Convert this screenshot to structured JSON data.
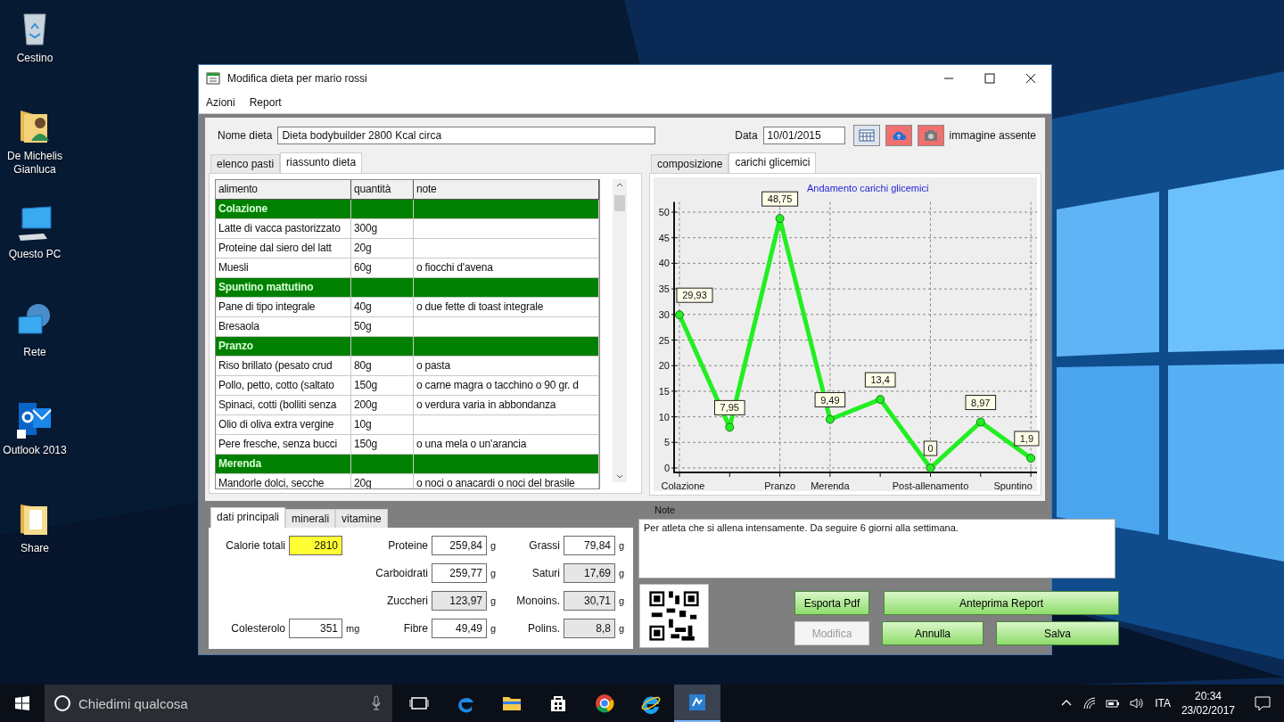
{
  "desktop": {
    "icons": [
      {
        "label": "Cestino",
        "kind": "bin"
      },
      {
        "label": "De Michelis Gianluca",
        "kind": "user"
      },
      {
        "label": "Questo PC",
        "kind": "pc"
      },
      {
        "label": "Rete",
        "kind": "network"
      },
      {
        "label": "Outlook 2013",
        "kind": "outlook"
      },
      {
        "label": "Share",
        "kind": "folder"
      }
    ]
  },
  "window": {
    "title": "Modifica dieta per mario rossi"
  },
  "menu": [
    "Azioni",
    "Report"
  ],
  "header": {
    "name_label": "Nome dieta",
    "name_value": "Dieta bodybuilder 2800 Kcal circa",
    "date_label": "Data",
    "date_value": "10/01/2015",
    "image_status": "immagine assente"
  },
  "left_tabs": [
    {
      "label": "elenco pasti",
      "selected": false
    },
    {
      "label": "riassunto dieta",
      "selected": true
    }
  ],
  "table": {
    "columns": [
      "alimento",
      "quantità",
      "note"
    ],
    "rows": [
      {
        "kind": "meal",
        "cells": [
          "Colazione"
        ]
      },
      {
        "kind": "food",
        "cells": [
          "Latte di vacca pastorizzato",
          "300g"
        ]
      },
      {
        "kind": "food",
        "cells": [
          "Proteine dal siero del latt",
          "20g"
        ]
      },
      {
        "kind": "food",
        "cells": [
          "Muesli",
          "60g",
          "o fiocchi d'avena"
        ]
      },
      {
        "kind": "meal",
        "cells": [
          "Spuntino mattutino"
        ]
      },
      {
        "kind": "food",
        "cells": [
          "Pane di tipo integrale",
          "40g",
          "o due fette di toast integrale"
        ]
      },
      {
        "kind": "food",
        "cells": [
          "Bresaola",
          "50g"
        ]
      },
      {
        "kind": "meal",
        "cells": [
          "Pranzo"
        ]
      },
      {
        "kind": "food",
        "cells": [
          "Riso brillato (pesato crud",
          "80g",
          "o pasta"
        ]
      },
      {
        "kind": "food",
        "cells": [
          "Pollo, petto, cotto (saltato",
          "150g",
          "o carne magra o tacchino o 90 gr. d"
        ]
      },
      {
        "kind": "food",
        "cells": [
          "Spinaci, cotti (bolliti senza",
          "200g",
          "o verdura varia in abbondanza"
        ]
      },
      {
        "kind": "food",
        "cells": [
          "Olio di oliva extra vergine",
          "10g"
        ]
      },
      {
        "kind": "food",
        "cells": [
          "Pere fresche, senza bucci",
          "150g",
          "o una mela o un'arancia"
        ]
      },
      {
        "kind": "meal",
        "cells": [
          "Merenda"
        ]
      },
      {
        "kind": "food",
        "cells": [
          "Mandorle dolci, secche",
          "20g",
          "o noci o anacardi o noci del brasile"
        ]
      }
    ]
  },
  "chart_tabs": [
    {
      "label": "composizione",
      "selected": false
    },
    {
      "label": "carichi glicemici",
      "selected": true
    }
  ],
  "chart": {
    "chart_data": {
      "type": "line",
      "title": "Andamento carichi glicemici",
      "categories": [
        "Colazione",
        null,
        "Pranzo",
        "Merenda",
        null,
        "Post-allenamento",
        null,
        "Spuntino"
      ],
      "yticks": [
        0,
        5,
        10,
        15,
        20,
        25,
        30,
        35,
        40,
        45,
        50
      ],
      "ylim": [
        0,
        52
      ],
      "grid": true,
      "series": [
        {
          "color": "#22ee22",
          "marker": true,
          "values": [
            29.93,
            7.95,
            48.75,
            9.49,
            13.4,
            0,
            8.97,
            1.92
          ]
        }
      ],
      "value_labels": [
        "29,93",
        "7,95",
        "48,75",
        "9,49",
        "13,4",
        "0",
        "8,97",
        "1,9"
      ]
    }
  },
  "bottom_tabs": [
    {
      "label": "dati principali",
      "selected": true
    },
    {
      "label": "minerali",
      "selected": false
    },
    {
      "label": "vitamine",
      "selected": false
    }
  ],
  "nutrients": {
    "rows": [
      {
        "left": {
          "label": "Calorie totali",
          "value": "2810",
          "highlighted": true,
          "readonly": false
        },
        "middle": {
          "label": "Proteine",
          "value": "259,84",
          "unit": "g",
          "highlighted": false,
          "readonly": false
        },
        "right": {
          "label": "Grassi",
          "value": "79,84",
          "unit": "g",
          "highlighted": false,
          "readonly": false
        }
      },
      {
        "middle": {
          "label": "Carboidrati",
          "value": "259,77",
          "unit": "g",
          "highlighted": false,
          "readonly": false
        },
        "right": {
          "label": "Saturi",
          "value": "17,69",
          "unit": "g",
          "highlighted": false,
          "readonly": true
        }
      },
      {
        "middle": {
          "label": "Zuccheri",
          "value": "123,97",
          "unit": "g",
          "highlighted": false,
          "readonly": true
        },
        "right": {
          "label": "Monoins.",
          "value": "30,71",
          "unit": "g",
          "highlighted": false,
          "readonly": true
        }
      },
      {
        "left": {
          "label": "Colesterolo",
          "value": "351",
          "unit": "mg",
          "highlighted": false,
          "readonly": false
        },
        "middle": {
          "label": "Fibre",
          "value": "49,49",
          "unit": "g",
          "highlighted": false,
          "readonly": false
        },
        "right": {
          "label": "Polins.",
          "value": "8,8",
          "unit": "g",
          "highlighted": false,
          "readonly": true
        }
      }
    ]
  },
  "note": {
    "label": "Note",
    "value": "Per atleta che si allena intensamente. Da seguire 6 giorni alla settimana."
  },
  "buttons": [
    {
      "label": "Esporta Pdf",
      "disabled": false
    },
    {
      "label": "Anteprima Report",
      "disabled": false
    },
    {
      "label": "Modifica",
      "disabled": true
    },
    {
      "label": "Annulla",
      "disabled": false
    },
    {
      "label": "Salva",
      "disabled": false
    }
  ],
  "taskbar": {
    "search_placeholder": "Chiedimi qualcosa",
    "apps": [
      {
        "kind": "taskview",
        "active": false
      },
      {
        "kind": "edge",
        "active": false
      },
      {
        "kind": "explorer",
        "active": false
      },
      {
        "kind": "store",
        "active": false
      },
      {
        "kind": "chrome",
        "active": false
      },
      {
        "kind": "ie",
        "active": false
      },
      {
        "kind": "app",
        "active": true
      }
    ],
    "language": "ITA",
    "time": "20:34",
    "date": "23/02/2017"
  }
}
